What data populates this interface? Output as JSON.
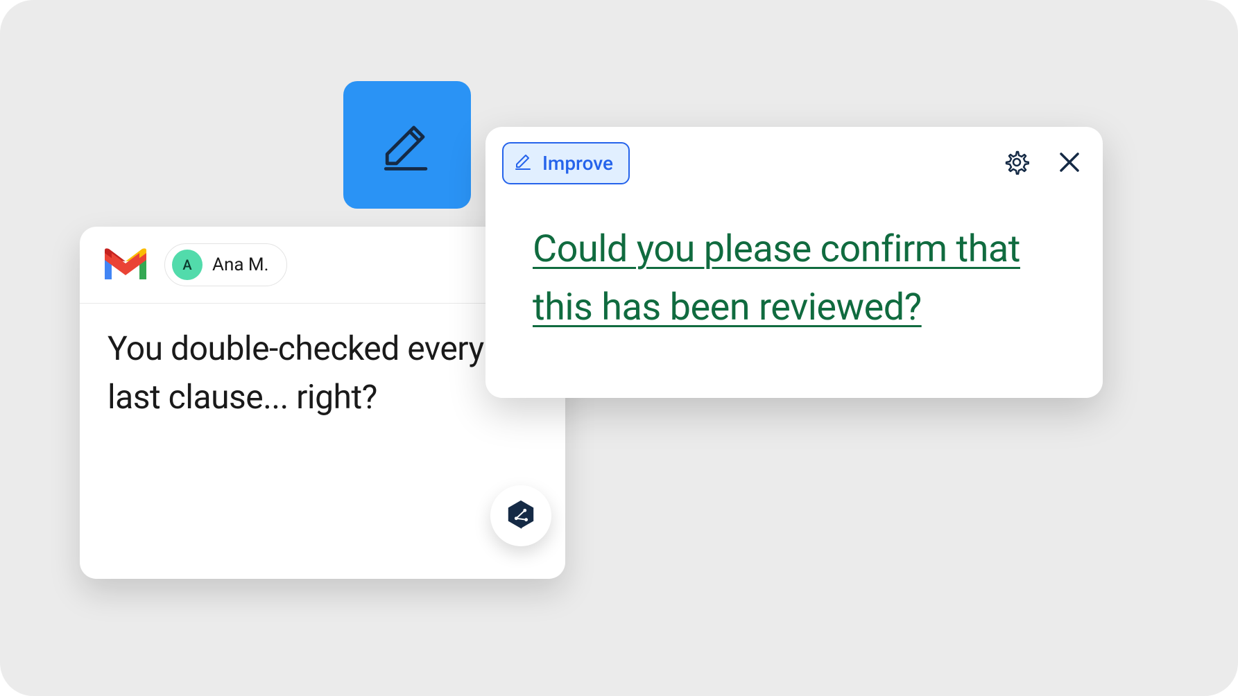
{
  "email": {
    "sender_initial": "A",
    "sender_name": "Ana M.",
    "body": "You double-checked every last clause... right?"
  },
  "suggestion": {
    "improve_label": "Improve",
    "text": "Could you please confirm that this has been reviewed?"
  },
  "icons": {
    "pencil": "pencil-icon",
    "gmail": "gmail-icon",
    "gear": "gear-icon",
    "close": "close-icon",
    "share": "share-icon"
  },
  "colors": {
    "tile_bg": "#2a93f5",
    "improve_border": "#2563eb",
    "improve_bg": "#e1efff",
    "suggest_text": "#106b3f",
    "avatar_bg": "#52dbab"
  }
}
